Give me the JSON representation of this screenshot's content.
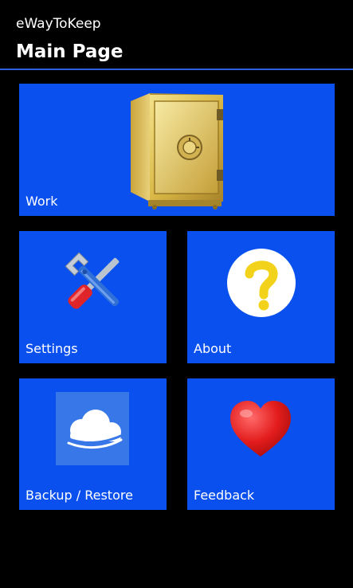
{
  "header": {
    "app_title": "eWayToKeep",
    "page_title": "Main Page"
  },
  "colors": {
    "background": "#000000",
    "tile": "#0a50ef",
    "accent_rule": "#2d5fe0",
    "text": "#ffffff"
  },
  "tiles": [
    {
      "label": "Work",
      "icon": "safe-icon"
    },
    {
      "label": "Settings",
      "icon": "wrench-screwdriver-icon"
    },
    {
      "label": "About",
      "icon": "question-mark-icon"
    },
    {
      "label": "Backup / Restore",
      "icon": "cloud-icon"
    },
    {
      "label": "Feedback",
      "icon": "heart-icon"
    }
  ]
}
